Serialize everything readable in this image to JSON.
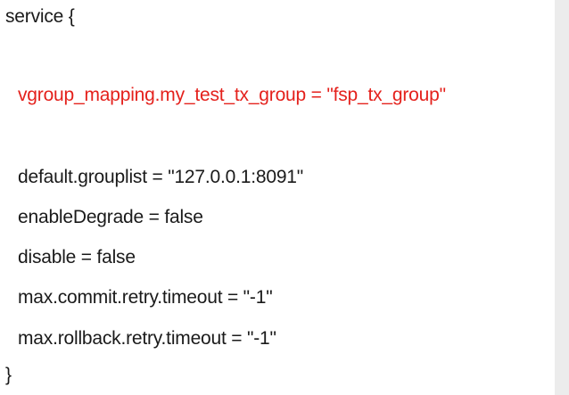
{
  "code": {
    "open": "service {",
    "highlight": "vgroup_mapping.my_test_tx_group = \"fsp_tx_group\"",
    "lines": [
      "default.grouplist = \"127.0.0.1:8091\"",
      "enableDegrade = false",
      "disable = false",
      "max.commit.retry.timeout = \"-1\"",
      "max.rollback.retry.timeout = \"-1\""
    ],
    "close": "}"
  },
  "colors": {
    "text": "#1a1a1a",
    "highlight": "#e4211c"
  }
}
